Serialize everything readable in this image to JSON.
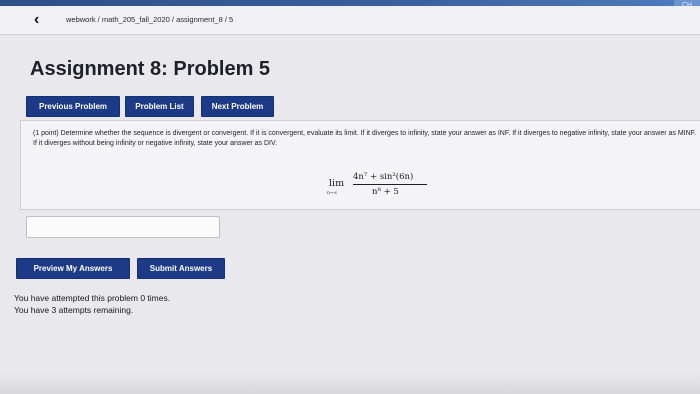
{
  "navbar": {
    "back_icon": "chevron-left-icon",
    "breadcrumb": "webwork / math_205_fall_2020 / assignment_8 / 5"
  },
  "corner_badge": "CH",
  "page_title": "Assignment 8: Problem 5",
  "nav_buttons": {
    "previous": "Previous Problem",
    "list": "Problem List",
    "next": "Next Problem"
  },
  "problem": {
    "text": "(1 point) Determine whether the sequence is divergent or convergent. If it is convergent, evaluate its limit. If it diverges to infinity, state your answer as INF. If it diverges to negative infinity, state your answer as MINF. If it diverges without being infinity or negative infinity, state your answer as DIV.",
    "lim": "lim",
    "lim_sub": "n→∞",
    "numerator": "4n⁷ + sin²(6n)",
    "denominator": "n⁸ + 5"
  },
  "answer": {
    "value": ""
  },
  "actions": {
    "preview": "Preview My Answers",
    "submit": "Submit Answers"
  },
  "status": {
    "attempted": "You have attempted this problem 0 times.",
    "remaining": "You have 3 attempts remaining."
  },
  "colors": {
    "button_bg": "#1c3a85",
    "top_strip": "#2c4f86",
    "page_bg": "#e9e8ec"
  }
}
